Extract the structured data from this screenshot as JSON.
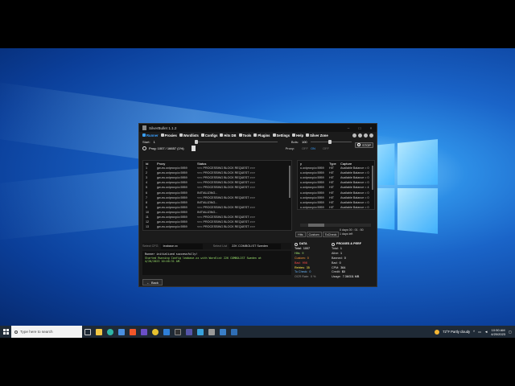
{
  "window": {
    "title": "SilverBullet 1.1.2"
  },
  "nav": {
    "items": [
      {
        "label": "Runner",
        "icon": "play-icon"
      },
      {
        "label": "Proxies",
        "icon": "shield-icon"
      },
      {
        "label": "Wordlists",
        "icon": "list-icon"
      },
      {
        "label": "Configs",
        "icon": "gear-icon"
      },
      {
        "label": "Hits DB",
        "icon": "database-icon"
      },
      {
        "label": "Tools",
        "icon": "wrench-icon"
      },
      {
        "label": "Plugins",
        "icon": "puzzle-icon"
      },
      {
        "label": "Settings",
        "icon": "settings-icon"
      },
      {
        "label": "Help",
        "icon": "help-icon"
      },
      {
        "label": "Silver Zone",
        "icon": "star-icon"
      }
    ]
  },
  "runner": {
    "start_label": "Start:",
    "start_value": "1",
    "bots_label": "Bots:",
    "bots_value": "100",
    "prog_text": "Prog: 1007 / 16657  (1%)",
    "proxy_label": "Proxy:",
    "proxy_off": "OFF",
    "proxy_on": "ON",
    "proxy_off2": "OFF",
    "stop_label": "STOP"
  },
  "left_table": {
    "headers": [
      "Id",
      "Proxy",
      "Status"
    ],
    "rows": [
      [
        "1",
        "gw-eu.oxiproxy.io:5959",
        "<<< PROCESSING BLOCK REQUEST >>>"
      ],
      [
        "2",
        "gw-eu.oxiproxy.io:5959",
        "<<< PROCESSING BLOCK REQUEST >>>"
      ],
      [
        "3",
        "gw-eu.oxiproxy.io:5959",
        "<<< PROCESSING BLOCK REQUEST >>>"
      ],
      [
        "4",
        "gw-eu.oxiproxy.io:5959",
        "<<< PROCESSING BLOCK REQUEST >>>"
      ],
      [
        "5",
        "gw-eu.oxiproxy.io:5959",
        "<<< PROCESSING BLOCK REQUEST >>>"
      ],
      [
        "6",
        "gw-eu.oxiproxy.io:5959",
        "INITIALIZING..."
      ],
      [
        "7",
        "gw-eu.oxiproxy.io:5959",
        "<<< PROCESSING BLOCK REQUEST >>>"
      ],
      [
        "8",
        "gw-eu.oxiproxy.io:5959",
        "INITIALIZING..."
      ],
      [
        "9",
        "gw-eu.oxiproxy.io:5959",
        "<<< PROCESSING BLOCK REQUEST >>>"
      ],
      [
        "10",
        "gw-eu.oxiproxy.io:5959",
        "INITIALIZING..."
      ],
      [
        "11",
        "gw-eu.oxiproxy.io:5959",
        "<<< PROCESSING BLOCK REQUEST >>>"
      ],
      [
        "12",
        "gw-eu.oxiproxy.io:5959",
        "<<< PROCESSING BLOCK REQUEST >>>"
      ],
      [
        "13",
        "gw-eu.oxiproxy.io:5959",
        "<<< PROCESSING BLOCK REQUEST >>>"
      ]
    ]
  },
  "right_table": {
    "headers": [
      "y",
      "Type",
      "Capture"
    ],
    "rows": [
      [
        "u.oxiproxy.io:5959",
        "HIT",
        "Available Balance = 0"
      ],
      [
        "u.oxiproxy.io:5959",
        "HIT",
        "Available Balance = 0"
      ],
      [
        "u.oxiproxy.io:5959",
        "HIT",
        "Available Balance = 0"
      ],
      [
        "u.oxiproxy.io:5959",
        "HIT",
        "Available Balance = 0"
      ],
      [
        "u.oxiproxy.io:5959",
        "HIT",
        "Available Balance = 4"
      ],
      [
        "u.oxiproxy.io:5959",
        "HIT",
        "Available Balance = 0"
      ],
      [
        "u.oxiproxy.io:5959",
        "HIT",
        "Available Balance = 0"
      ],
      [
        "u.oxiproxy.io:5959",
        "HIT",
        "Available Balance = 0"
      ],
      [
        "u.oxiproxy.io:5959",
        "HIT",
        "Available Balance = 0"
      ]
    ],
    "tabs": [
      "Hits",
      "Custom",
      "ToCheck"
    ],
    "time_line1": "0 days 00 : 01 : 50",
    "time_line2": "1 days left"
  },
  "select_row": {
    "config_label": "Select CFG",
    "config_value": "leabase.xx",
    "list_label": "Select List",
    "list_value": "22K COMBOLIST Sweden"
  },
  "log": {
    "line1": "Runner initialized successfully!",
    "line2": "Started Running Config leabase.xx with Wordlist 22K COMBOLIST Sweden at",
    "line3": "4/20/2023 10:46:31 AM."
  },
  "back_label": "Back",
  "stats": {
    "data_title": "DATA",
    "data": [
      {
        "label": "Total:",
        "value": "1007",
        "color": "#ffffff"
      },
      {
        "label": "Hits:",
        "value": "9",
        "color": "#9fe870"
      },
      {
        "label": "Custom:",
        "value": "0",
        "color": "#ff9a3a"
      },
      {
        "label": "Bad:",
        "value": "998",
        "color": "#ff4a4a"
      },
      {
        "label": "Retries:",
        "value": "35",
        "color": "#ffe84a"
      },
      {
        "label": "To Check:",
        "value": "0",
        "color": "#6ab8ff"
      },
      {
        "label": "OCR Rate:",
        "value": "0 %",
        "color": "#999999"
      }
    ],
    "proxies_title": "PROXIES & PERF",
    "proxies": [
      {
        "label": "Total:",
        "value": "1"
      },
      {
        "label": "Alive:",
        "value": "1"
      },
      {
        "label": "Banned:",
        "value": "0"
      },
      {
        "label": "Bad:",
        "value": "0"
      },
      {
        "label": "CPM:",
        "value": "364"
      },
      {
        "label": "Credit:",
        "value": "$0"
      },
      {
        "label": "Usage:",
        "value": "7.36/311 MB"
      }
    ]
  },
  "taskbar": {
    "search_placeholder": "Type here to search",
    "weather": "72°F  Partly cloudy",
    "time": "10:50 AM",
    "date": "4/20/2023"
  },
  "colors": {
    "accent": "#3aa0ff",
    "hits": "#9fe870"
  }
}
